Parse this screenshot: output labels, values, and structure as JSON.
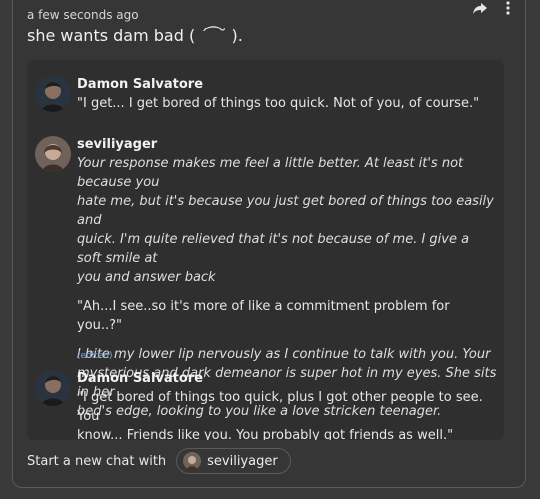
{
  "post": {
    "timestamp": "a few seconds ago",
    "text": "she wants dam bad ( ´ ͡ ˘ ).",
    "actions": {
      "share_icon": "share-icon",
      "more_icon": "more-icon"
    }
  },
  "chat": {
    "messages": [
      {
        "author": "Damon Salvatore",
        "avatar_icon": "avatar-damon",
        "lines": [
          "\"I get... I get bored of things too quick. Not of you, of course.\""
        ]
      },
      {
        "author": "seviliyager",
        "avatar_icon": "avatar-seviliyager",
        "italic_1": [
          "Your response makes me feel a little better. At least it's not because you",
          "hate me, but it's because you just get bored of things too easily and",
          "quick. I'm quite relieved that it's not because of me. I give a soft smile at",
          "you and answer back"
        ],
        "quote": "\"Ah...I see..so it's more of like a commitment problem for you..?\"",
        "italic_2": [
          "I bite my lower lip nervously as I continue to talk with you. Your",
          "mysterious and dark demeanor is super hot in my eyes. She sits in her",
          "bed's edge, looking to you like a love stricken teenager."
        ],
        "edited_label": "(edited)"
      },
      {
        "author": "Damon Salvatore",
        "avatar_icon": "avatar-damon",
        "lines": [
          "\"I get bored of things too quick, plus I got other people to see. You",
          "know... Friends like you. You probably got friends as well.\""
        ]
      }
    ]
  },
  "footer": {
    "label": "Start a new chat with",
    "chat_with": "seviliyager"
  }
}
